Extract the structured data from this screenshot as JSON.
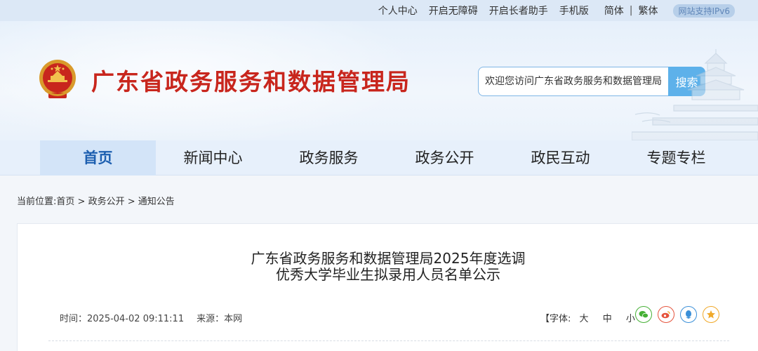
{
  "topbar": {
    "links": [
      "个人中心",
      "开启无障碍",
      "开启长者助手",
      "手机版"
    ],
    "lang_simplified": "简体",
    "lang_separator": "|",
    "lang_traditional": "繁体",
    "ipv6_badge": "网站支持IPv6"
  },
  "header": {
    "site_title": "广东省政务服务和数据管理局",
    "search_placeholder": "欢迎您访问广东省政务服务和数据管理局",
    "search_button": "搜索"
  },
  "nav": {
    "items": [
      "首页",
      "新闻中心",
      "政务服务",
      "政务公开",
      "政民互动",
      "专题专栏"
    ],
    "active_index": 0
  },
  "breadcrumb": {
    "prefix": "当前位置:",
    "items": [
      "首页",
      "政务公开",
      "通知公告"
    ],
    "separator": ">"
  },
  "article": {
    "title_line1": "广东省政务服务和数据管理局2025年度选调",
    "title_line2": "优秀大学毕业生拟录用人员名单公示",
    "time_label": "时间：",
    "time_value": "2025-04-02 09:11:11",
    "source_label": "来源：",
    "source_value": "本网",
    "font_label": "【字体:",
    "font_sizes": [
      "大",
      "中",
      "小"
    ],
    "font_close": "】"
  },
  "share_icons": [
    {
      "name": "wechat-icon",
      "color": "#45b035"
    },
    {
      "name": "weibo-icon",
      "color": "#e5533c"
    },
    {
      "name": "qq-icon",
      "color": "#3a8fd8"
    },
    {
      "name": "favorite-star-icon",
      "color": "#f0a92a"
    }
  ],
  "colors": {
    "title_red": "#c8261d",
    "accent_blue": "#5db1ea",
    "nav_active": "#1d5fb0"
  }
}
